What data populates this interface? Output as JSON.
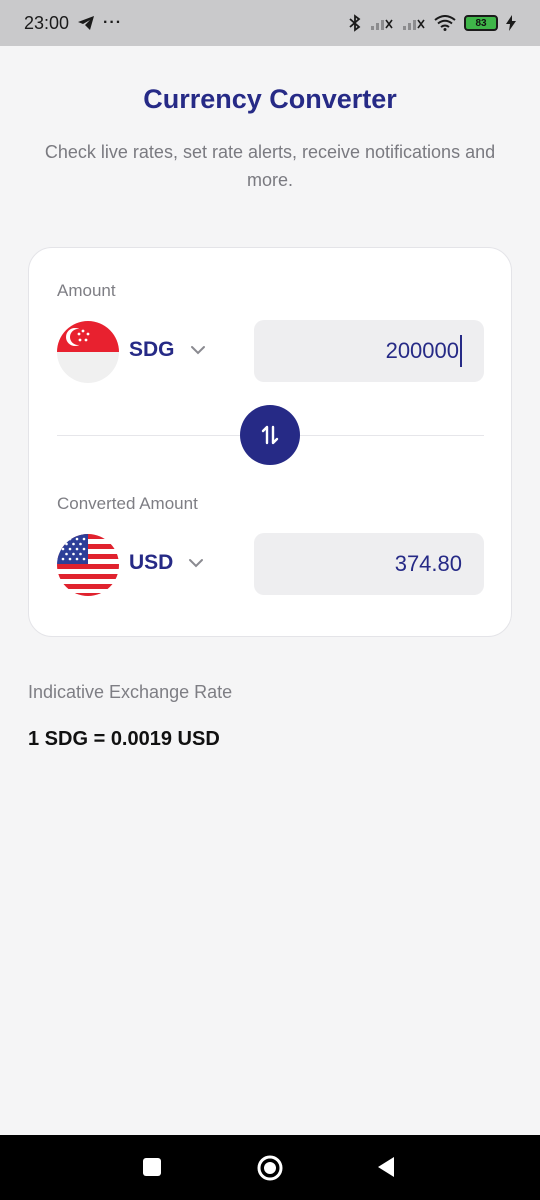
{
  "status_bar": {
    "time": "23:00",
    "battery": "83",
    "icons": [
      "telegram-icon",
      "more-icon",
      "bluetooth-icon",
      "signal-icon",
      "signal-icon",
      "wifi-icon",
      "battery-icon",
      "charging-icon"
    ]
  },
  "header": {
    "title": "Currency Converter",
    "subtitle": "Check live rates, set rate alerts, receive notifications and more."
  },
  "converter": {
    "amount_label": "Amount",
    "from_currency": "SDG",
    "amount_value": "200000",
    "converted_label": "Converted Amount",
    "to_currency": "USD",
    "converted_value": "374.80"
  },
  "rate": {
    "label": "Indicative Exchange Rate",
    "value": "1 SDG = 0.0019 USD"
  },
  "colors": {
    "accent": "#262a86",
    "background": "#f5f5f6"
  }
}
